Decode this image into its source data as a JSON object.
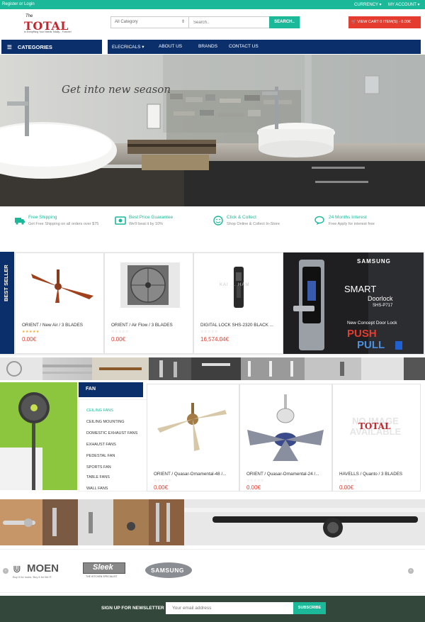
{
  "topbar": {
    "register": "Register",
    "or": " or ",
    "login": "Login",
    "currency": "CURRENCY ▾",
    "account": "MY ACCOUNT ▾"
  },
  "logo": {
    "the": "The",
    "word": "TOTAL",
    "tagline": "Is Everything Your Needs Totally... Forever!"
  },
  "search": {
    "category": "All Category",
    "placeholder": "Search..",
    "button": "SEARCH.."
  },
  "cart": {
    "label": "VIEW CART 0 ITEM(S) - 0.00€"
  },
  "categories_label": "CATEGORIES",
  "nav": {
    "items": [
      "ELECRICALS ▾",
      "ABOUT US",
      "BRANDS",
      "CONTACT US"
    ]
  },
  "hero": {
    "tagline": "Get into new season"
  },
  "features": [
    {
      "title": "Free Shipping",
      "desc": "Get Free Shipping on all orders over $75",
      "icon": "truck-icon"
    },
    {
      "title": "Best Price Guarantee",
      "desc": "We'll beat it by 10%",
      "icon": "money-icon"
    },
    {
      "title": "Click & Collect",
      "desc": "Shop Online & Collect In-Store",
      "icon": "smile-icon"
    },
    {
      "title": "24 Months Interest",
      "desc": "Free Apply for interest free",
      "icon": "chat-icon"
    }
  ],
  "bestseller": {
    "label": "BEST SELLER",
    "products": [
      {
        "name": "ORIENT / New Air / 3 BLADES",
        "price": "0.00€",
        "rated": true
      },
      {
        "name": "ORIENT / Air Flow / 3 BLADES",
        "price": "0.00€",
        "rated": false
      },
      {
        "name": "DIGITAL LOCK SHS-2320 BLACK ...",
        "price": "16,574.04€",
        "rated": false
      }
    ],
    "lock_brand_text": "KAI ... HAM"
  },
  "samsung_ad": {
    "brand": "SAMSUNG",
    "smart": "SMART",
    "doorlock": "Doorlock",
    "model": "SHS-P717",
    "concept": "New Concept Door Lock",
    "push": "PUSH",
    "pull": "PULL"
  },
  "fan": {
    "heading": "FAN",
    "menu": [
      "CEILING FANS",
      "CEILING MOUNTING",
      "DOMESTIC EXHAUST FANS",
      "EXHAUST FANS",
      "PEDESTAL FAN",
      "SPORTS FAN",
      "TABLE FANS",
      "WALL FANS"
    ],
    "products": [
      {
        "name": "ORIENT / Quasar-Ornamental-48 /...",
        "price": "0.00€"
      },
      {
        "name": "ORIENT / Quasar-Ornamental-24 /...",
        "price": "0.00€"
      },
      {
        "name": "HAVELLS / Quanto / 3 BLADES",
        "price": "0.00€"
      }
    ],
    "no_image": "NO IMAGE AVAILABLE",
    "no_image_logo": "TOTAL"
  },
  "brands": {
    "moen": "MOEN",
    "moen_tag": "Buy it for looks. Buy it for life.®",
    "sleek": "Sleek",
    "sleek_tag": "THE KITCHEN SPECIALIST",
    "samsung": "SAMSUNG"
  },
  "newsletter": {
    "label": "SIGN UP FOR NEWSLETTER",
    "placeholder": "Your email address",
    "button": "SUBSCRIBE"
  },
  "colors": {
    "accent": "#1cb89a",
    "navy": "#0b2f6b",
    "red": "#e43c2e"
  }
}
